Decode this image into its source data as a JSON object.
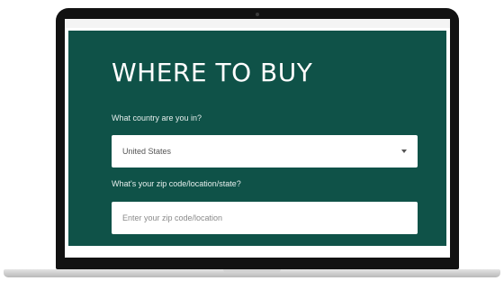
{
  "where_to_buy": {
    "title": "WHERE TO BUY",
    "country": {
      "label": "What country are you in?",
      "selected": "United States"
    },
    "zip": {
      "label": "What's your zip code/location/state?",
      "placeholder": "Enter your zip code/location",
      "value": ""
    }
  },
  "colors": {
    "panel_background": "#0f5248",
    "bezel": "#121212",
    "text_on_panel": "#ffffff"
  },
  "icons": {
    "country_select": "chevron-down-icon"
  }
}
